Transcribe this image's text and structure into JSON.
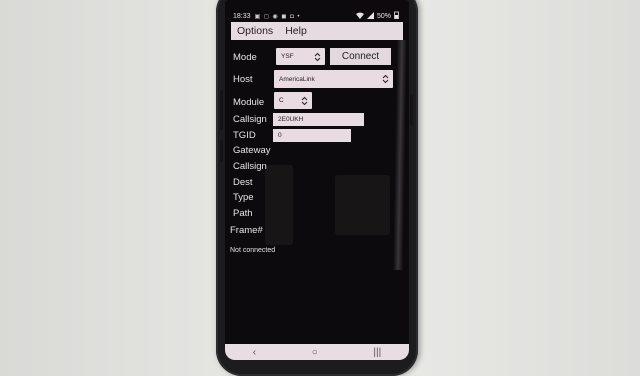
{
  "status_bar": {
    "time": "18:33",
    "notification_icons": "▣ ◻ ◉ ◼ ◘ •",
    "battery": "50%"
  },
  "menu": {
    "options": "Options",
    "help": "Help"
  },
  "form": {
    "mode_label": "Mode",
    "mode_value": "YSF",
    "connect_label": "Connect",
    "host_label": "Host",
    "host_value": "AmericaLink",
    "module_label": "Module",
    "module_value": "C",
    "callsign_label": "Callsign",
    "callsign_value": "2E0UKH",
    "tgid_label": "TGID",
    "tgid_value": "0"
  },
  "info": {
    "gateway_label": "Gateway",
    "callsign_label": "Callsign",
    "dest_label": "Dest",
    "type_label": "Type",
    "path_label": "Path",
    "frame_label": "Frame#"
  },
  "status_message": "Not connected",
  "nav": {
    "back": "‹",
    "home": "○",
    "recents": "|||"
  }
}
